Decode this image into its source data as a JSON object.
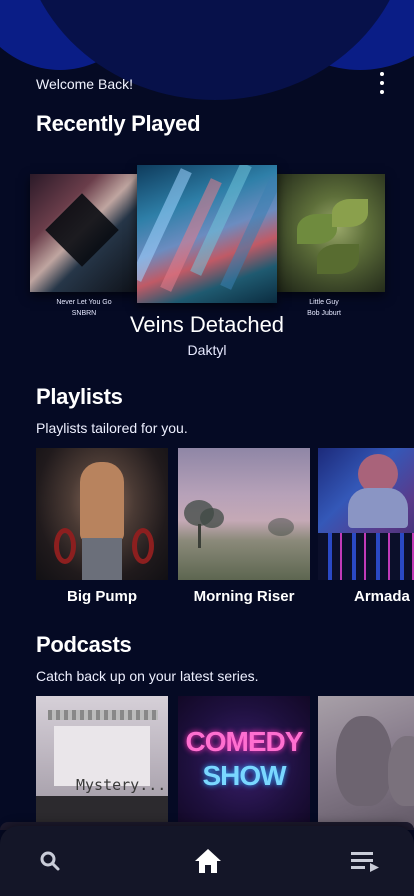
{
  "header": {
    "welcome": "Welcome Back!",
    "menu_icon": "more-vertical-icon"
  },
  "recently_played": {
    "title": "Recently Played",
    "items": [
      {
        "title": "Never Let You Go",
        "artist": "SNBRN"
      },
      {
        "title": "Veins Detached",
        "artist": "Daktyl"
      },
      {
        "title": "Little Guy",
        "artist": "Bob Juburt"
      }
    ]
  },
  "playlists": {
    "title": "Playlists",
    "subtitle": "Playlists tailored for you.",
    "items": [
      {
        "label": "Big Pump"
      },
      {
        "label": "Morning Riser"
      },
      {
        "label": "Armada"
      }
    ]
  },
  "podcasts": {
    "title": "Podcasts",
    "subtitle": "Catch back up on your latest series.",
    "items": [
      {
        "cover_text": "Mystery..."
      },
      {
        "cover_text_1": "COMEDY",
        "cover_text_2": "SHOW"
      },
      {
        "cover_text": ""
      }
    ]
  },
  "nav": {
    "items": [
      {
        "icon": "search-icon"
      },
      {
        "icon": "home-icon"
      },
      {
        "icon": "queue-icon"
      }
    ]
  },
  "colors": {
    "background": "#050a24",
    "blob": "#0a1d86",
    "navbar": "#141628"
  }
}
